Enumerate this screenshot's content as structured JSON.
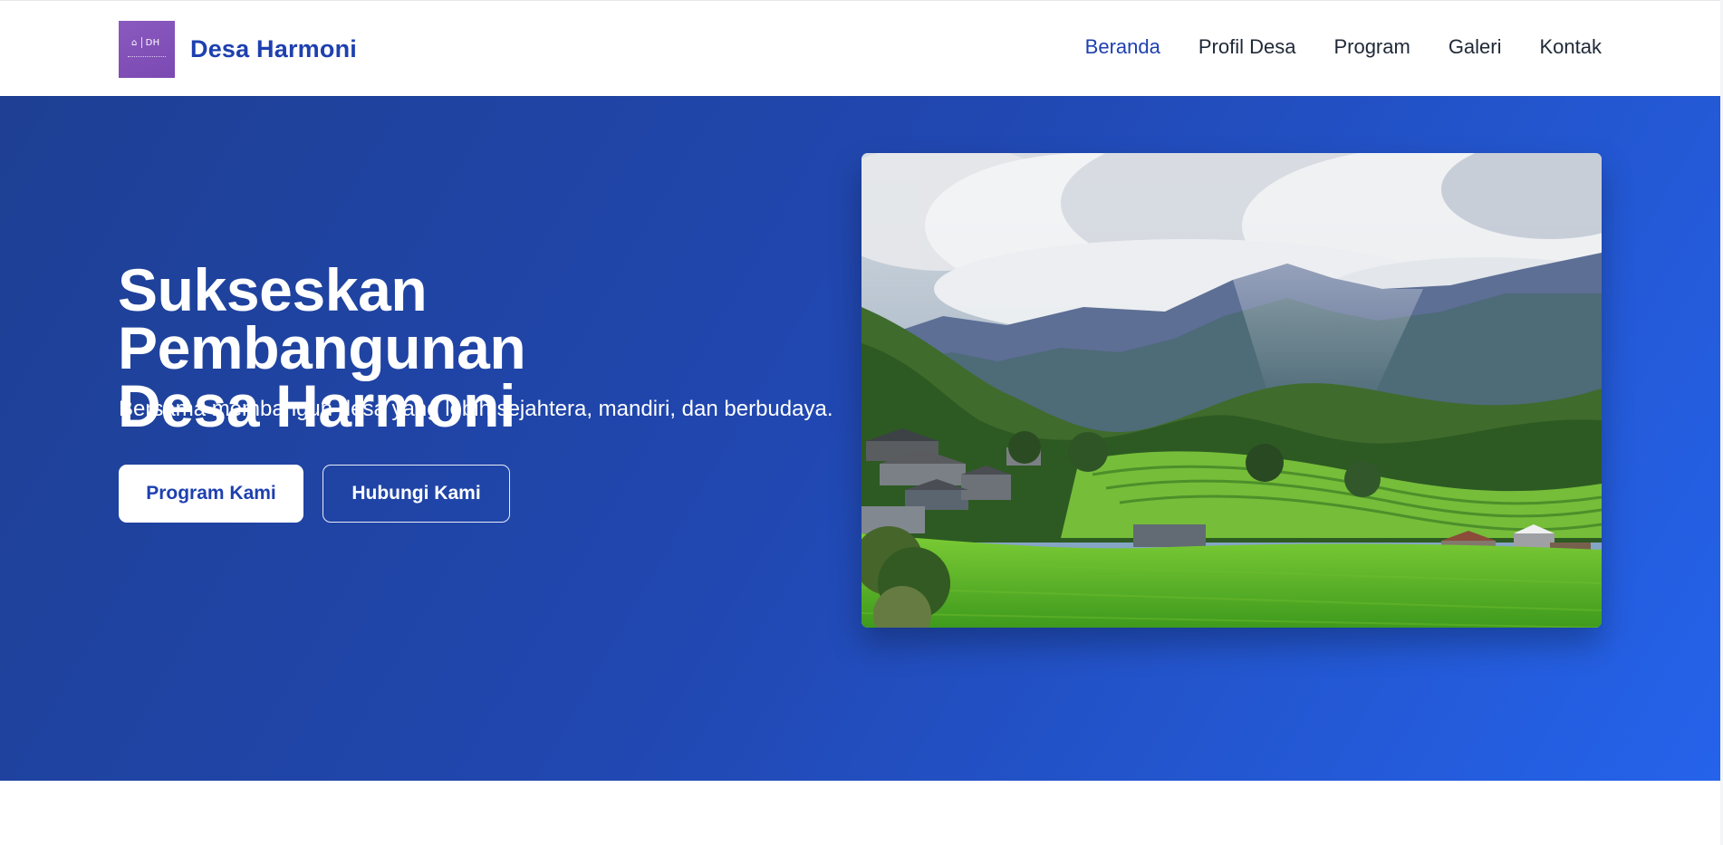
{
  "site": {
    "name": "Desa Harmoni",
    "logo_text": "DH",
    "nav": [
      {
        "label": "Beranda",
        "active": true
      },
      {
        "label": "Profil Desa",
        "active": false
      },
      {
        "label": "Program",
        "active": false
      },
      {
        "label": "Galeri",
        "active": false
      },
      {
        "label": "Kontak",
        "active": false
      }
    ]
  },
  "hero": {
    "title_line1": "Sukseskan Pembangunan",
    "title_line2": "Desa Harmoni",
    "subtitle": "Bersama membangun desa yang lebih sejahtera, mandiri, dan berbudaya.",
    "primary_button": "Program Kami",
    "secondary_button": "Hubungi Kami",
    "image_subject": "mountain-village-landscape"
  },
  "colors": {
    "brand": "#1e40af",
    "hero_gradient_start": "#1e3f93",
    "hero_gradient_end": "#2563eb",
    "logo_purple": "#8a5abf"
  }
}
